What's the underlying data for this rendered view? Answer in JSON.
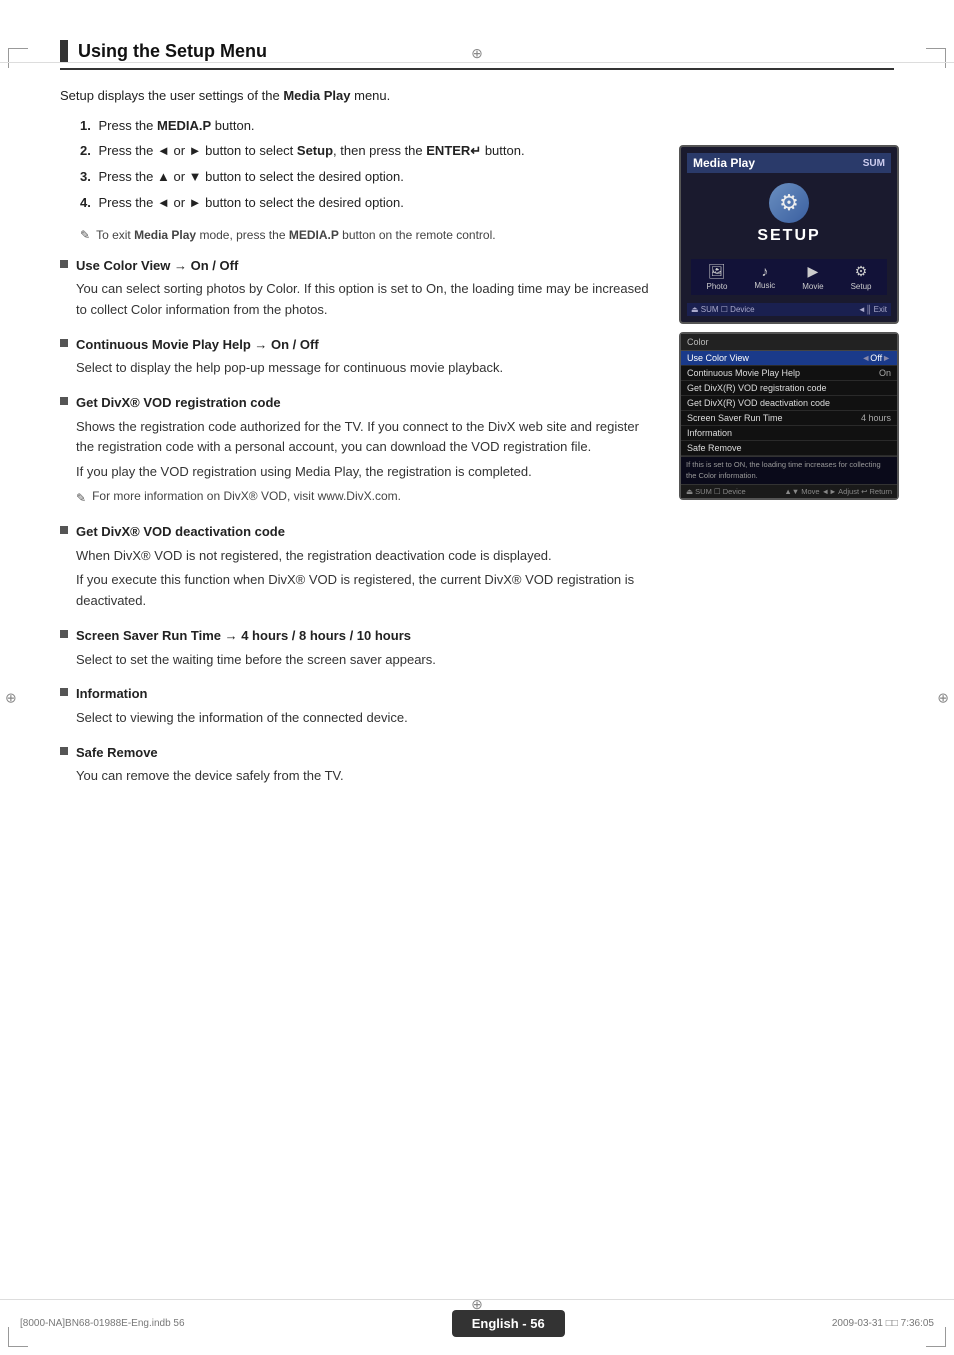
{
  "page": {
    "title": "Using the Setup Menu",
    "footer_center": "English - 56",
    "footer_left": "[8000-NA]BN68-01988E-Eng.indb   56",
    "footer_right": "2009-03-31   □□ 7:36:05"
  },
  "intro": {
    "text": "Setup displays the user settings of the Media Play menu."
  },
  "steps": [
    {
      "num": "1.",
      "text": "Press the MEDIA.P button."
    },
    {
      "num": "2.",
      "text": "Press the ◄ or ► button to select Setup, then press the ENTER↵ button."
    },
    {
      "num": "3.",
      "text": "Press the ▲ or ▼ button to select the desired option."
    },
    {
      "num": "4.",
      "text": "Press the ◄ or ► button to select the desired option."
    }
  ],
  "note": {
    "text": "To exit Media Play mode, press the MEDIA.P button on the remote control."
  },
  "bullets": [
    {
      "id": "color-view",
      "title": "Use Color View → On / Off",
      "body": [
        "You can select sorting photos by Color. If this option is set to On, the loading time may be increased to collect Color information from the photos."
      ]
    },
    {
      "id": "continuous-movie",
      "title": "Continuous Movie Play Help → On / Off",
      "body": [
        "Select to display the help pop-up message for continuous movie playback."
      ]
    },
    {
      "id": "divx-reg",
      "title": "Get DivX® VOD registration code",
      "body": [
        "Shows the registration code authorized for the TV. If you connect to the DivX web site and register the registration code with a personal account, you can download the VOD registration file.",
        "If you play the VOD registration using Media Play, the registration is completed.",
        "✎   For more information on DivX® VOD, visit www.DivX.com."
      ]
    },
    {
      "id": "divx-deact",
      "title": "Get DivX® VOD deactivation code",
      "body": [
        "When DivX® VOD is not registered, the registration deactivation code is displayed.",
        "If you execute this function when DivX® VOD is registered, the current DivX® VOD registration is deactivated."
      ]
    },
    {
      "id": "screen-saver",
      "title": "Screen Saver Run Time → 4 hours / 8 hours / 10 hours",
      "body": [
        "Select to set the waiting time before the screen saver appears."
      ]
    },
    {
      "id": "information",
      "title": "Information",
      "body": [
        "Select to viewing the information of the connected device."
      ]
    },
    {
      "id": "safe-remove",
      "title": "Safe Remove",
      "body": [
        "You can remove the device safely from the TV."
      ]
    }
  ],
  "screenshot1": {
    "top_label": "Media Play",
    "right_label": "SUM",
    "device_label": "Device",
    "setup_label": "SETUP",
    "icons": [
      {
        "sym": "🖼",
        "label": "Photo"
      },
      {
        "sym": "♪",
        "label": "Music"
      },
      {
        "sym": "🎬",
        "label": "Movie"
      },
      {
        "sym": "⚙",
        "label": "Setup"
      }
    ],
    "exit_label": "◄║ Exit"
  },
  "screenshot2": {
    "menu_rows": [
      {
        "label": "Use Color View",
        "value": "◄  Off  ►",
        "highlighted": true
      },
      {
        "label": "Continuous Movie Play Help",
        "value": "On",
        "highlighted": false
      },
      {
        "label": "Get DivX(R) VOD registration code",
        "value": "",
        "highlighted": false
      },
      {
        "label": "Get DivX(R) VOD deactivation code",
        "value": "",
        "highlighted": false
      },
      {
        "label": "Screen Saver Run Time",
        "value": "4 hours",
        "highlighted": false
      },
      {
        "label": "Information",
        "value": "",
        "highlighted": false
      },
      {
        "label": "Safe Remove",
        "value": "",
        "highlighted": false
      }
    ],
    "note_text": "If this is set to ON, the loading time increases for collecting the Color information.",
    "bottom_left": "SUM  Device",
    "bottom_right": "▲▼ Move  ◄► Adjust  ↩ Return"
  }
}
